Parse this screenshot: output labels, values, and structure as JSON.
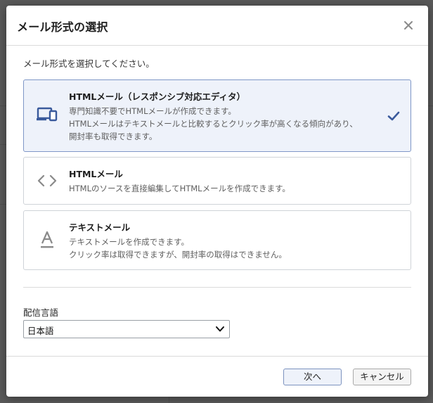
{
  "dialog": {
    "title": "メール形式の選択",
    "close_icon": "close-icon",
    "prompt": "メール形式を選択してください。"
  },
  "options": [
    {
      "title": "HTMLメール（レスポンシブ対応エディタ）",
      "desc": [
        "専門知識不要でHTMLメールが作成できます。",
        "HTMLメールはテキストメールと比較するとクリック率が高くなる傾向があり、",
        "開封率も取得できます。"
      ],
      "icon": "responsive-device-icon",
      "selected": true
    },
    {
      "title": "HTMLメール",
      "desc": [
        "HTMLのソースを直接編集してHTMLメールを作成できます。"
      ],
      "icon": "code-brackets-icon",
      "selected": false
    },
    {
      "title": "テキストメール",
      "desc": [
        "テキストメールを作成できます。",
        "クリック率は取得できますが、開封率の取得はできません。"
      ],
      "icon": "text-format-icon",
      "selected": false
    }
  ],
  "language": {
    "label": "配信言語",
    "value": "日本語"
  },
  "footer": {
    "next_label": "次へ",
    "cancel_label": "キャンセル"
  },
  "colors": {
    "accent": "#3a5a9c",
    "selected_bg": "#eef2fa",
    "selected_border": "#7f97c7"
  }
}
